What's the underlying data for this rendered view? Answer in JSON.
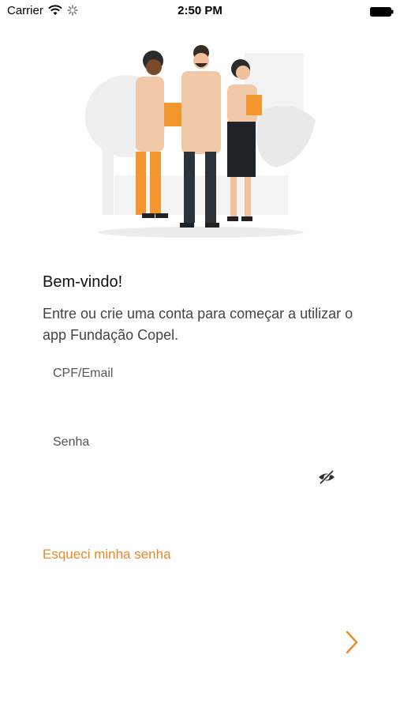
{
  "status_bar": {
    "carrier": "Carrier",
    "time": "2:50 PM"
  },
  "welcome": {
    "title": "Bem-vindo!",
    "subtitle": "Entre ou crie uma conta para começar a utilizar o app Fundação Copel."
  },
  "form": {
    "cpf_label": "CPF/Email",
    "cpf_value": "",
    "password_label": "Senha",
    "password_value": "",
    "visibility_icon": "eye-off-icon"
  },
  "forgot_password": "Esqueci minha senha",
  "next_icon": "chevron-right-icon",
  "colors": {
    "accent": "#e8892a",
    "text_primary": "#111111",
    "text_secondary": "#444444"
  }
}
